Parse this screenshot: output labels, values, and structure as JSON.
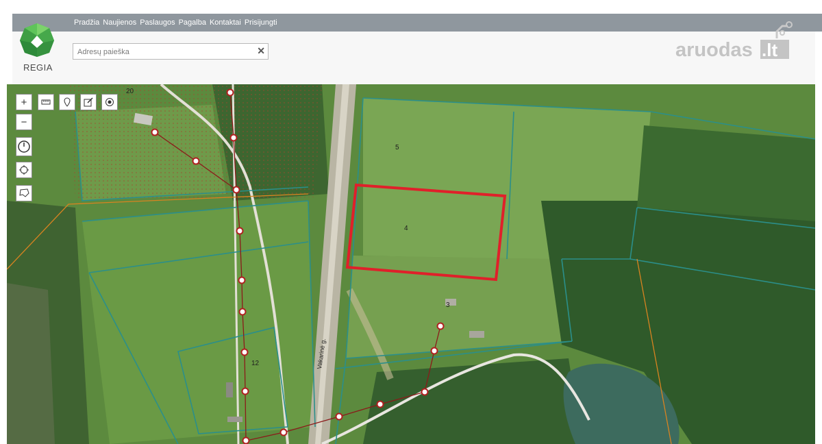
{
  "nav": {
    "items": [
      "Pradžia",
      "Naujienos",
      "Paslaugos",
      "Pagalba",
      "Kontaktai",
      "Prisijungti"
    ]
  },
  "logo": {
    "text": "REGIA"
  },
  "search": {
    "placeholder": "Adresų paieška",
    "clear_icon": "close-icon"
  },
  "brand": {
    "text": "aruodas",
    "suffix": ".lt"
  },
  "map": {
    "road_label": "Vakarinė g.",
    "parcel_labels": {
      "top_left": "20",
      "north": "5",
      "selected": "4",
      "south": "3",
      "house": "12"
    }
  },
  "tools": [
    "zoom-in",
    "zoom-out",
    "measure",
    "marker",
    "edit",
    "target",
    "history",
    "locate",
    "lasso"
  ],
  "colors": {
    "parcel_border": "#2b8f8a",
    "selected_parcel": "#e0202a",
    "power_line": "#8b1a1a",
    "boundary": "#d98320"
  }
}
